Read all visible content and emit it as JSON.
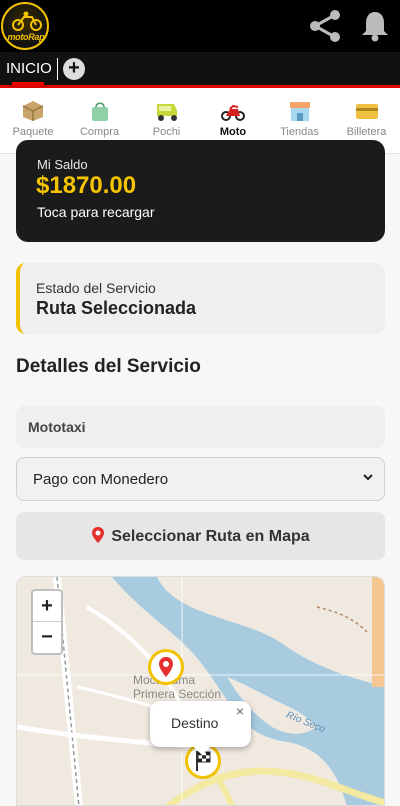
{
  "app": {
    "logo_text": "motoRapi",
    "share_icon": "share-icon",
    "bell_icon": "bell-icon"
  },
  "tabs": {
    "home_label": "INICIO",
    "add_icon": "plus-circle-icon"
  },
  "services": [
    {
      "label": "Paquete",
      "icon": "box-icon"
    },
    {
      "label": "Compra",
      "icon": "shopping-bag-icon"
    },
    {
      "label": "Pochi",
      "icon": "rickshaw-icon"
    },
    {
      "label": "Moto",
      "icon": "motorcycle-icon",
      "active": true
    },
    {
      "label": "Tiendas",
      "icon": "store-icon"
    },
    {
      "label": "Billetera",
      "icon": "wallet-icon"
    }
  ],
  "balance": {
    "label": "Mi Saldo",
    "amount": "$1870.00",
    "hint": "Toca para recargar"
  },
  "status": {
    "label": "Estado del Servicio",
    "value": "Ruta Seleccionada"
  },
  "details": {
    "title": "Detalles del Servicio",
    "vehicle": "Mototaxi",
    "payment_selected": "Pago con Monedero",
    "route_button": "Seleccionar Ruta en Mapa"
  },
  "map": {
    "zoom_in": "+",
    "zoom_out": "−",
    "town_label_1": "Moctezuma",
    "town_label_2": "Primera Sección",
    "river_label": "Río Seco",
    "popup_text": "Destino",
    "popup_close": "×"
  },
  "colors": {
    "accent": "#f2c200",
    "dark": "#1b1b1b",
    "alert": "#e00000"
  }
}
